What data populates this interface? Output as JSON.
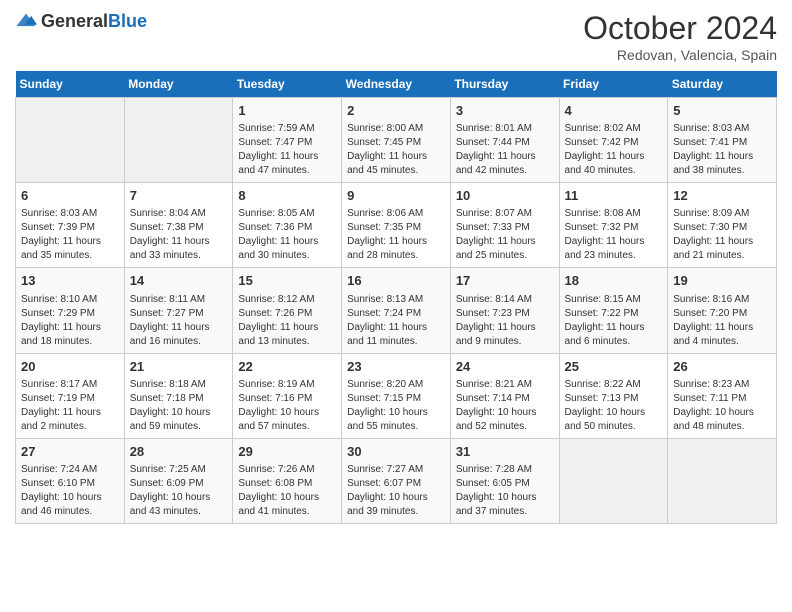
{
  "header": {
    "logo_general": "General",
    "logo_blue": "Blue",
    "month": "October 2024",
    "location": "Redovan, Valencia, Spain"
  },
  "weekdays": [
    "Sunday",
    "Monday",
    "Tuesday",
    "Wednesday",
    "Thursday",
    "Friday",
    "Saturday"
  ],
  "weeks": [
    [
      {
        "day": "",
        "info": ""
      },
      {
        "day": "",
        "info": ""
      },
      {
        "day": "1",
        "info": "Sunrise: 7:59 AM\nSunset: 7:47 PM\nDaylight: 11 hours and 47 minutes."
      },
      {
        "day": "2",
        "info": "Sunrise: 8:00 AM\nSunset: 7:45 PM\nDaylight: 11 hours and 45 minutes."
      },
      {
        "day": "3",
        "info": "Sunrise: 8:01 AM\nSunset: 7:44 PM\nDaylight: 11 hours and 42 minutes."
      },
      {
        "day": "4",
        "info": "Sunrise: 8:02 AM\nSunset: 7:42 PM\nDaylight: 11 hours and 40 minutes."
      },
      {
        "day": "5",
        "info": "Sunrise: 8:03 AM\nSunset: 7:41 PM\nDaylight: 11 hours and 38 minutes."
      }
    ],
    [
      {
        "day": "6",
        "info": "Sunrise: 8:03 AM\nSunset: 7:39 PM\nDaylight: 11 hours and 35 minutes."
      },
      {
        "day": "7",
        "info": "Sunrise: 8:04 AM\nSunset: 7:38 PM\nDaylight: 11 hours and 33 minutes."
      },
      {
        "day": "8",
        "info": "Sunrise: 8:05 AM\nSunset: 7:36 PM\nDaylight: 11 hours and 30 minutes."
      },
      {
        "day": "9",
        "info": "Sunrise: 8:06 AM\nSunset: 7:35 PM\nDaylight: 11 hours and 28 minutes."
      },
      {
        "day": "10",
        "info": "Sunrise: 8:07 AM\nSunset: 7:33 PM\nDaylight: 11 hours and 25 minutes."
      },
      {
        "day": "11",
        "info": "Sunrise: 8:08 AM\nSunset: 7:32 PM\nDaylight: 11 hours and 23 minutes."
      },
      {
        "day": "12",
        "info": "Sunrise: 8:09 AM\nSunset: 7:30 PM\nDaylight: 11 hours and 21 minutes."
      }
    ],
    [
      {
        "day": "13",
        "info": "Sunrise: 8:10 AM\nSunset: 7:29 PM\nDaylight: 11 hours and 18 minutes."
      },
      {
        "day": "14",
        "info": "Sunrise: 8:11 AM\nSunset: 7:27 PM\nDaylight: 11 hours and 16 minutes."
      },
      {
        "day": "15",
        "info": "Sunrise: 8:12 AM\nSunset: 7:26 PM\nDaylight: 11 hours and 13 minutes."
      },
      {
        "day": "16",
        "info": "Sunrise: 8:13 AM\nSunset: 7:24 PM\nDaylight: 11 hours and 11 minutes."
      },
      {
        "day": "17",
        "info": "Sunrise: 8:14 AM\nSunset: 7:23 PM\nDaylight: 11 hours and 9 minutes."
      },
      {
        "day": "18",
        "info": "Sunrise: 8:15 AM\nSunset: 7:22 PM\nDaylight: 11 hours and 6 minutes."
      },
      {
        "day": "19",
        "info": "Sunrise: 8:16 AM\nSunset: 7:20 PM\nDaylight: 11 hours and 4 minutes."
      }
    ],
    [
      {
        "day": "20",
        "info": "Sunrise: 8:17 AM\nSunset: 7:19 PM\nDaylight: 11 hours and 2 minutes."
      },
      {
        "day": "21",
        "info": "Sunrise: 8:18 AM\nSunset: 7:18 PM\nDaylight: 10 hours and 59 minutes."
      },
      {
        "day": "22",
        "info": "Sunrise: 8:19 AM\nSunset: 7:16 PM\nDaylight: 10 hours and 57 minutes."
      },
      {
        "day": "23",
        "info": "Sunrise: 8:20 AM\nSunset: 7:15 PM\nDaylight: 10 hours and 55 minutes."
      },
      {
        "day": "24",
        "info": "Sunrise: 8:21 AM\nSunset: 7:14 PM\nDaylight: 10 hours and 52 minutes."
      },
      {
        "day": "25",
        "info": "Sunrise: 8:22 AM\nSunset: 7:13 PM\nDaylight: 10 hours and 50 minutes."
      },
      {
        "day": "26",
        "info": "Sunrise: 8:23 AM\nSunset: 7:11 PM\nDaylight: 10 hours and 48 minutes."
      }
    ],
    [
      {
        "day": "27",
        "info": "Sunrise: 7:24 AM\nSunset: 6:10 PM\nDaylight: 10 hours and 46 minutes."
      },
      {
        "day": "28",
        "info": "Sunrise: 7:25 AM\nSunset: 6:09 PM\nDaylight: 10 hours and 43 minutes."
      },
      {
        "day": "29",
        "info": "Sunrise: 7:26 AM\nSunset: 6:08 PM\nDaylight: 10 hours and 41 minutes."
      },
      {
        "day": "30",
        "info": "Sunrise: 7:27 AM\nSunset: 6:07 PM\nDaylight: 10 hours and 39 minutes."
      },
      {
        "day": "31",
        "info": "Sunrise: 7:28 AM\nSunset: 6:05 PM\nDaylight: 10 hours and 37 minutes."
      },
      {
        "day": "",
        "info": ""
      },
      {
        "day": "",
        "info": ""
      }
    ]
  ]
}
